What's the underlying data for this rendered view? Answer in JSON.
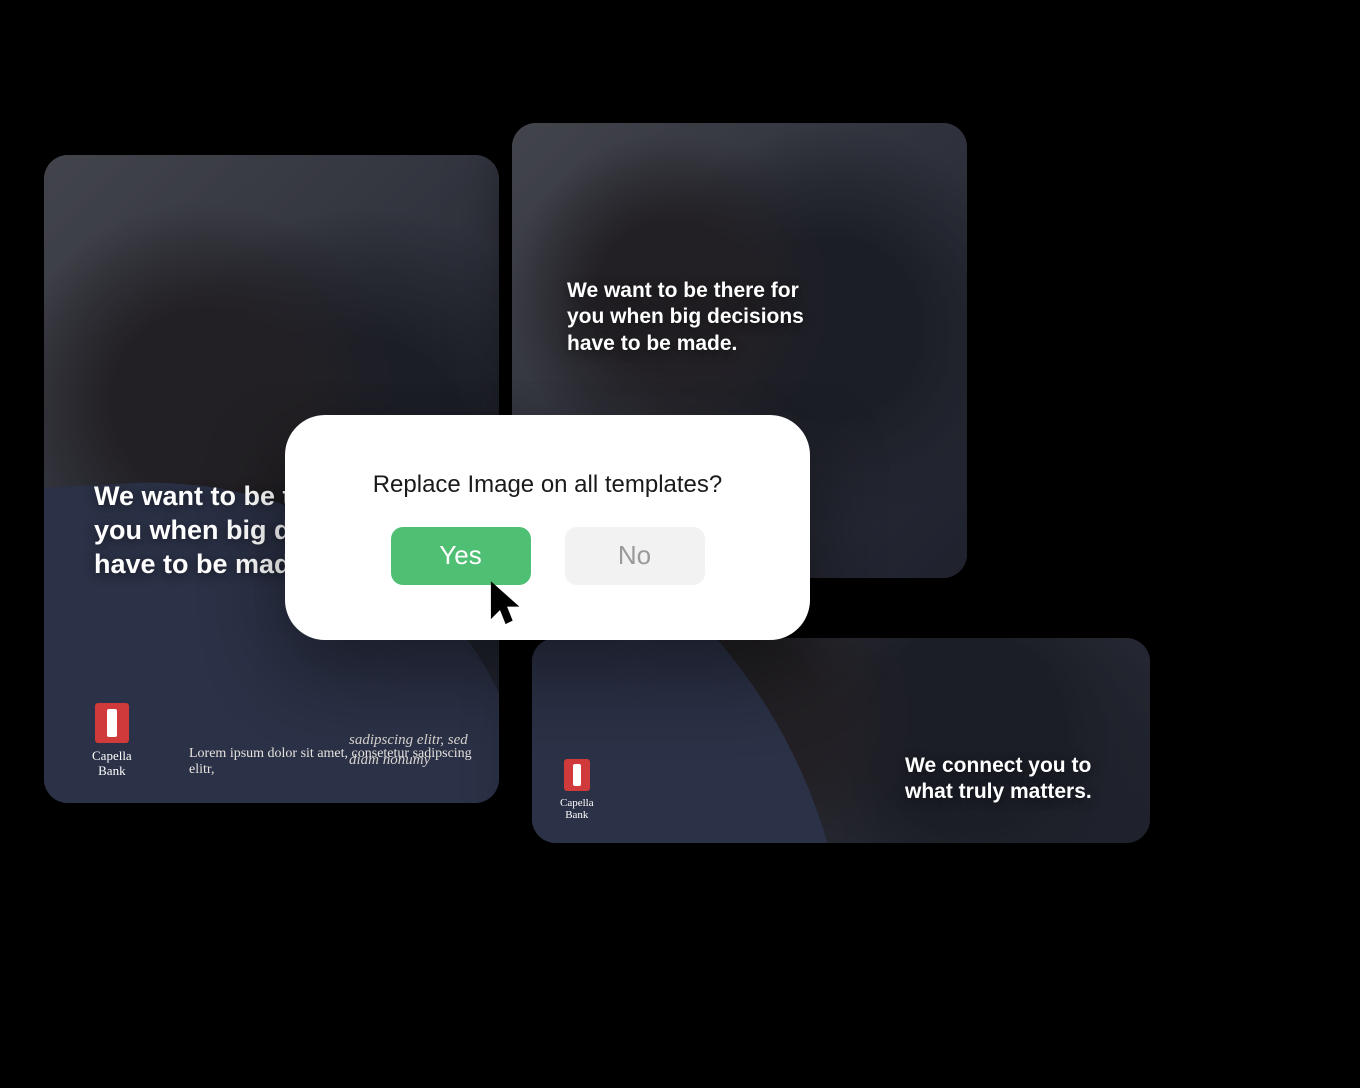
{
  "brand": {
    "name_line1": "Capella",
    "name_line2": "Bank"
  },
  "cards": {
    "a": {
      "headline": "We want to be there for you when big decisions have to be made.",
      "subtext": "sadipscing elitr, sed diam nonumy",
      "footer": "Lorem ipsum dolor sit amet, consetetur sadipscing elitr,"
    },
    "b": {
      "headline": "We want to be there for you when big decisions have to be made."
    },
    "c": {
      "headline": "We connect you to what truly matters."
    }
  },
  "dialog": {
    "title": "Replace Image on all templates?",
    "yes": "Yes",
    "no": "No"
  }
}
